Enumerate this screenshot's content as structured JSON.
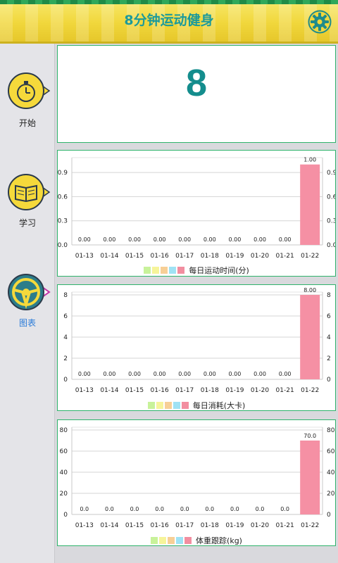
{
  "app": {
    "title": "8分钟运动健身"
  },
  "sidebar": {
    "items": [
      {
        "label": "开始",
        "icon": "stopwatch-icon"
      },
      {
        "label": "学习",
        "icon": "book-icon"
      },
      {
        "label": "图表",
        "icon": "steering-wheel-icon"
      }
    ],
    "active_index": 2
  },
  "counter": {
    "value": "8"
  },
  "legend_colors": [
    "#c8f29a",
    "#f6f49a",
    "#f7cf96",
    "#9fe2f4",
    "#f28ea0"
  ],
  "colors": {
    "bar": "#f590a4",
    "accent": "#1c9a9a",
    "panel_border": "#2fb36b",
    "active_label": "#2a7bd8"
  },
  "chart_data": [
    {
      "type": "bar",
      "legend_label": "每日运动时间(分)",
      "categories": [
        "01-13",
        "01-14",
        "01-15",
        "01-16",
        "01-17",
        "01-18",
        "01-19",
        "01-20",
        "01-21",
        "01-22"
      ],
      "values": [
        0,
        0,
        0,
        0,
        0,
        0,
        0,
        0,
        0,
        1
      ],
      "value_labels": [
        "0.00",
        "0.00",
        "0.00",
        "0.00",
        "0.00",
        "0.00",
        "0.00",
        "0.00",
        "0.00",
        "1.00"
      ],
      "yticks": [
        "0.0",
        "0.3",
        "0.6",
        "0.9"
      ],
      "ytick_values": [
        0,
        0.3,
        0.6,
        0.9
      ],
      "ylim": [
        0,
        1.05
      ],
      "grid": true
    },
    {
      "type": "bar",
      "legend_label": "每日消耗(大卡)",
      "categories": [
        "01-13",
        "01-14",
        "01-15",
        "01-16",
        "01-17",
        "01-18",
        "01-19",
        "01-20",
        "01-21",
        "01-22"
      ],
      "values": [
        0,
        0,
        0,
        0,
        0,
        0,
        0,
        0,
        0,
        8
      ],
      "value_labels": [
        "0.00",
        "0.00",
        "0.00",
        "0.00",
        "0.00",
        "0.00",
        "0.00",
        "0.00",
        "0.00",
        "8.00"
      ],
      "yticks": [
        "0",
        "2",
        "4",
        "6",
        "8"
      ],
      "ytick_values": [
        0,
        2,
        4,
        6,
        8
      ],
      "ylim": [
        0,
        8
      ],
      "grid": true
    },
    {
      "type": "bar",
      "legend_label": "体重跟踪(kg)",
      "categories": [
        "01-13",
        "01-14",
        "01-15",
        "01-16",
        "01-17",
        "01-18",
        "01-19",
        "01-20",
        "01-21",
        "01-22"
      ],
      "values": [
        0,
        0,
        0,
        0,
        0,
        0,
        0,
        0,
        0,
        70
      ],
      "value_labels": [
        "0.0",
        "0.0",
        "0.0",
        "0.0",
        "0.0",
        "0.0",
        "0.0",
        "0.0",
        "0.0",
        "70.0"
      ],
      "yticks": [
        "0",
        "20",
        "40",
        "60",
        "80"
      ],
      "ytick_values": [
        0,
        20,
        40,
        60,
        80
      ],
      "ylim": [
        0,
        80
      ],
      "grid": true
    }
  ]
}
